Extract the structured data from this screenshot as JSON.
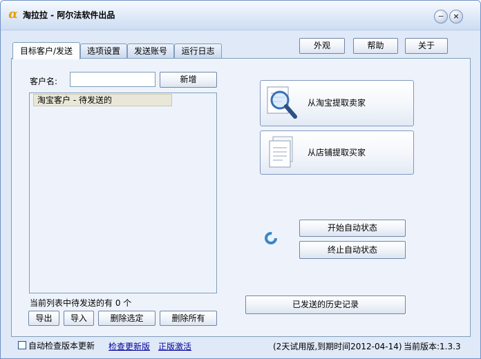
{
  "window": {
    "title": "淘拉拉 - 阿尔法软件出品",
    "logo_glyph": "α",
    "minimize_glyph": "−",
    "close_glyph": "×"
  },
  "toolbar": {
    "appearance_label": "外观",
    "help_label": "帮助",
    "about_label": "关于"
  },
  "tabs": [
    {
      "label": "目标客户/发送",
      "active": true
    },
    {
      "label": "选项设置",
      "active": false
    },
    {
      "label": "发送账号",
      "active": false
    },
    {
      "label": "运行日志",
      "active": false
    }
  ],
  "customer": {
    "name_label": "客户名:",
    "name_value": "",
    "add_label": "新增",
    "list_group": "淘宝客户 - 待发送的",
    "pending_summary": "当前列表中待发送的有 0 个",
    "export_label": "导出",
    "import_label": "导入",
    "delete_selected_label": "删除选定",
    "delete_all_label": "删除所有"
  },
  "actions": {
    "fetch_sellers_label": "从淘宝提取卖家",
    "fetch_buyers_label": "从店铺提取买家",
    "start_auto_label": "开始自动状态",
    "stop_auto_label": "终止自动状态",
    "history_label": "已发送的历史记录"
  },
  "status": {
    "auto_check_label": "自动检查版本更新",
    "auto_check_checked": false,
    "check_update_link": "检查更新版",
    "activate_link": "正版激活",
    "trial_info": "(2天试用版,到期时间2012-04-14)",
    "version_label": "当前版本:1.3.3"
  },
  "colors": {
    "window_bg": "#dfe9f7",
    "panel_bg": "#eef3fb",
    "link": "#00009c",
    "logo": "#e8a000"
  }
}
